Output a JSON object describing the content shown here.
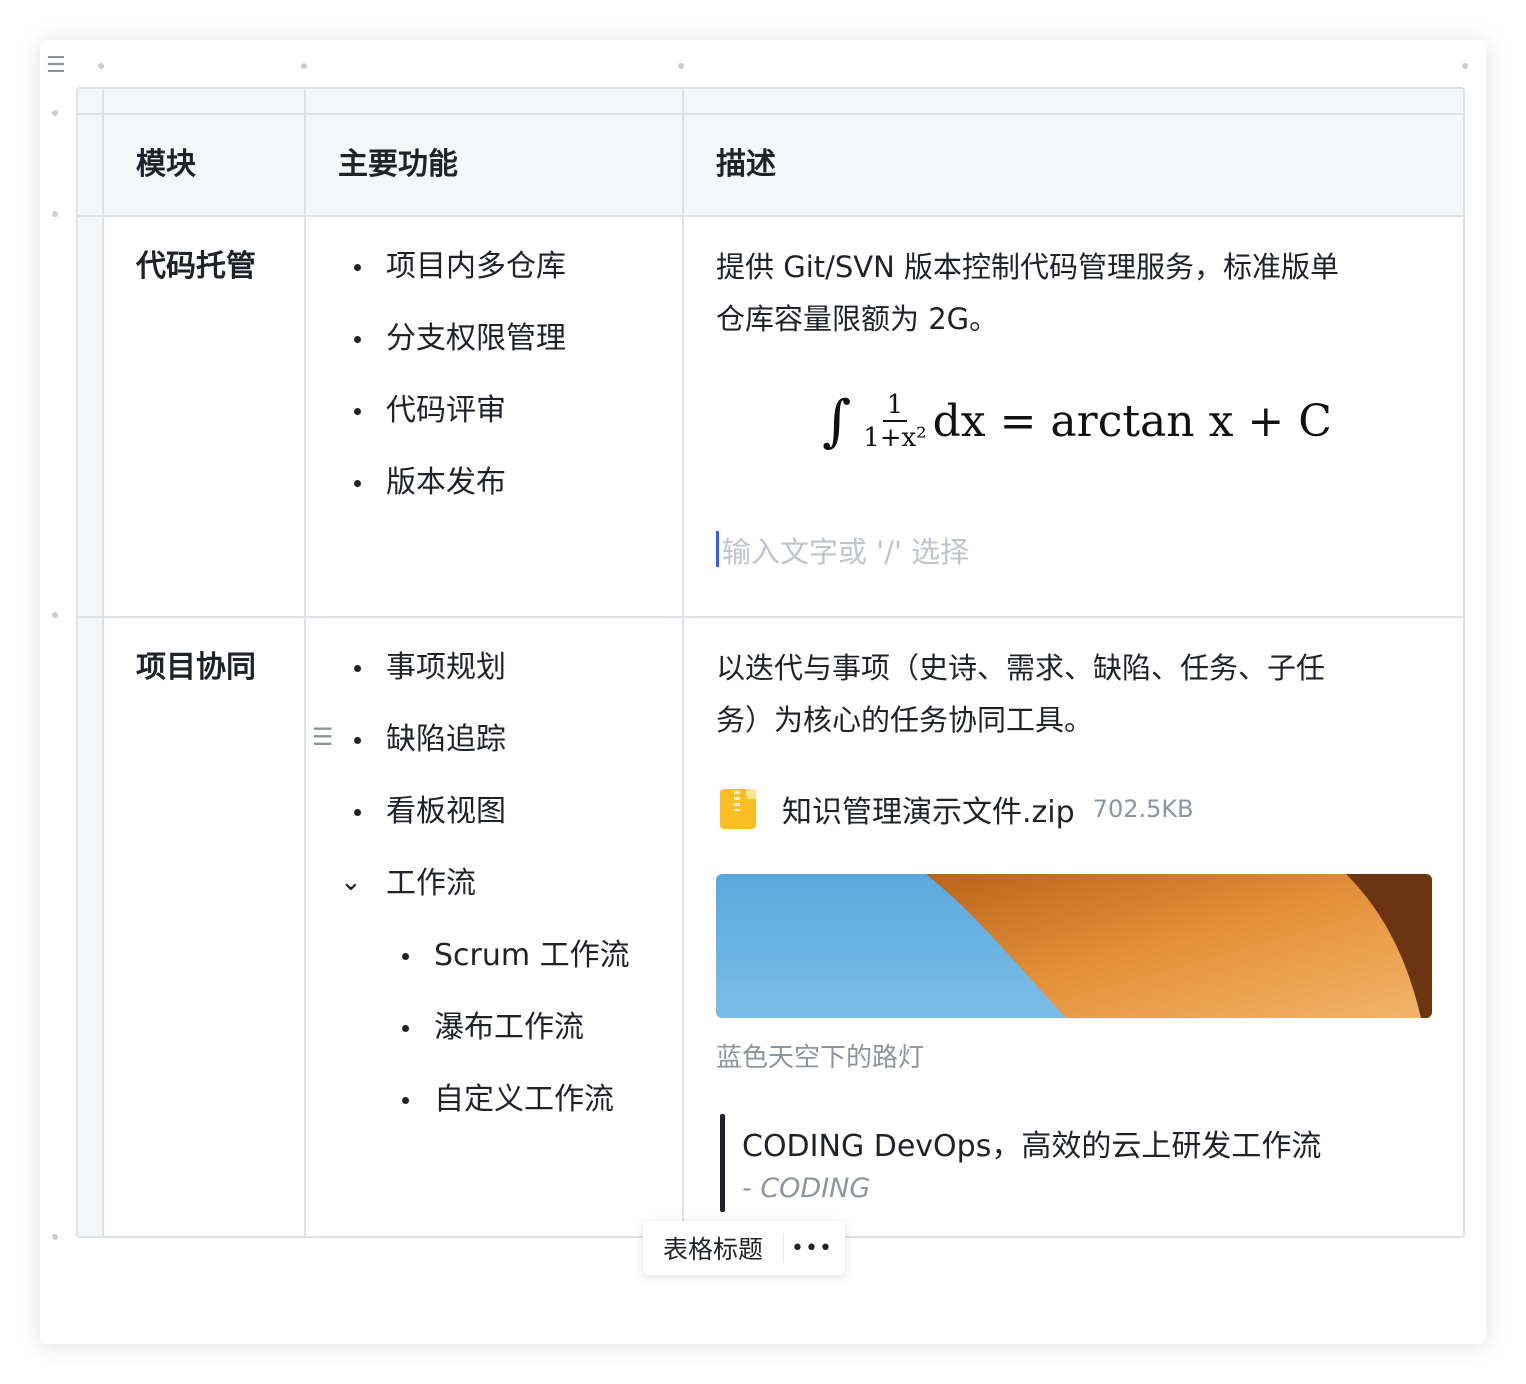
{
  "table": {
    "headers": [
      "模块",
      "主要功能",
      "描述"
    ],
    "rows": [
      {
        "module": "代码托管",
        "features": [
          "项目内多仓库",
          "分支权限管理",
          "代码评审",
          "版本发布"
        ],
        "description": "提供 Git/SVN 版本控制代码管理服务，标准版单仓库容量限额为 2G。",
        "description_lines": [
          "提供 Git/SVN 版本控制代码管理服务，标准版单",
          "仓库容量限额为 2G。"
        ],
        "formula": {
          "integral": "∫",
          "numerator": "1",
          "denominator": "1+x²",
          "rhs": "dx = arctan x + C"
        },
        "placeholder": "输入文字或 '/' 选择"
      },
      {
        "module": "项目协同",
        "features": [
          "事项规划",
          "缺陷追踪",
          "看板视图",
          "工作流"
        ],
        "sub_features": [
          "Scrum 工作流",
          "瀑布工作流",
          "自定义工作流"
        ],
        "description_lines": [
          "以迭代与事项（史诗、需求、缺陷、任务、子任",
          "务）为核心的任务协同工具。"
        ],
        "file": {
          "name": "知识管理演示文件.zip",
          "size": "702.5KB"
        },
        "image_caption": "蓝色天空下的路灯",
        "quote": {
          "text": "CODING DevOps，高效的云上研发工作流",
          "author": "- CODING"
        }
      }
    ]
  },
  "caption_toolbar": {
    "title_label": "表格标题",
    "more_label": "•••"
  },
  "icons": {
    "drag_handle": "drag-handle-icon",
    "zip": "zip-file-icon",
    "chevron": "chevron-down-icon"
  },
  "colors": {
    "caret": "#2f5cf5",
    "zip": "#fbbf24",
    "border": "#dde1e8",
    "header_bg": "#f5f6f8"
  }
}
